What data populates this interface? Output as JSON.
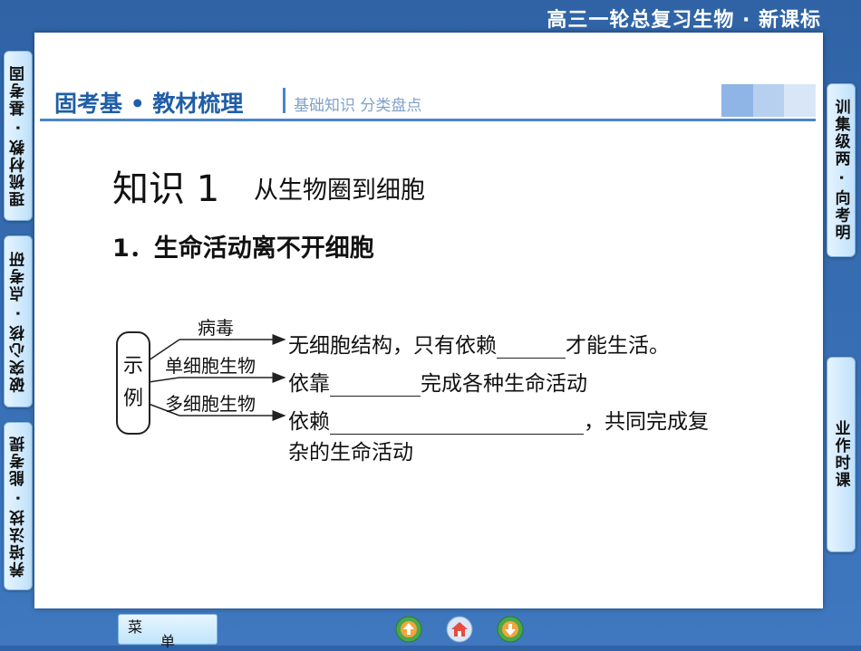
{
  "top_title": "高三一轮总复习生物 · 新课标",
  "header": {
    "main": "固考基 • 教材梳理",
    "sub": "基础知识  分类盘点"
  },
  "knowledge": {
    "title": "知识 1",
    "subtitle": "从生物圈到细胞"
  },
  "section": {
    "title": "1．生命活动离不开细胞"
  },
  "diagram": {
    "bracket_top": "示",
    "bracket_bottom": "例",
    "branches": [
      {
        "label": "病毒",
        "text_before": "无细胞结构，只有依赖",
        "text_after": "才能生活。"
      },
      {
        "label": "单细胞生物",
        "text_before": "依靠",
        "text_after": "完成各种生命活动"
      },
      {
        "label": "多细胞生物",
        "text_before": "依赖",
        "text_after": "，共同完成复",
        "text_line2": "杂的生命活动"
      }
    ]
  },
  "left_tabs": [
    "理梳材教 · 基考固",
    "破突心核 · 点考研",
    "养培法技 · 能考提"
  ],
  "right_tabs": [
    "训集级两 · 向考明",
    "业作时课"
  ],
  "menu": {
    "c1": "菜",
    "c2": "单"
  },
  "colors": {
    "accent": "#1f5ea8",
    "background": "#3f78bf"
  }
}
